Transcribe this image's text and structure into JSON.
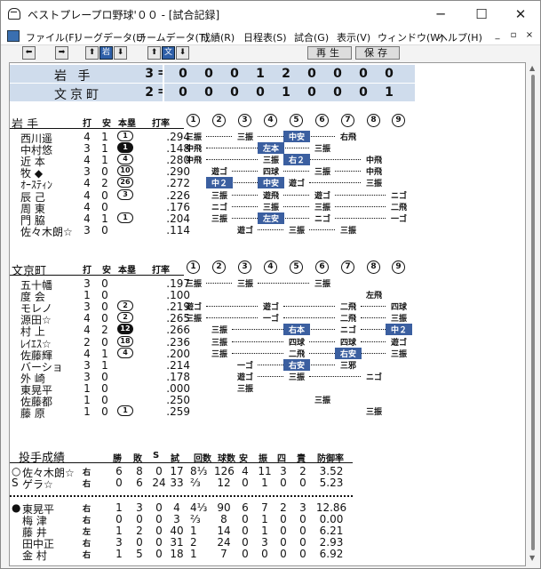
{
  "window": {
    "title": "ベストプレープロ野球'００ - [試合記録]",
    "controls": [
      "─",
      "☐",
      "✕"
    ]
  },
  "menu": {
    "items": [
      "ファイル(F)",
      "リーグデータ(L)",
      "チームデータ(T)",
      "成績(R)",
      "日程表(S)",
      "試合(G)",
      "表示(V)",
      "ウィンドウ(W)",
      "ヘルプ(H)"
    ],
    "mdi": [
      "_",
      "▫",
      "×"
    ]
  },
  "toolbar": {
    "prev": "⬅",
    "next": "➡",
    "iwate_up": "⬆",
    "iwate_label": "岩",
    "iwate_down": "⬇",
    "bunkyo_up": "⬆",
    "bunkyo_label": "文",
    "bunkyo_down": "⬇",
    "replay": "再生",
    "save": "保存"
  },
  "linescore": {
    "teams": [
      {
        "name": "岩 手",
        "total": "3",
        "innings": [
          "0",
          "0",
          "0",
          "1",
          "2",
          "0",
          "0",
          "0",
          "0"
        ]
      },
      {
        "name": "文京町",
        "total": "2",
        "innings": [
          "0",
          "0",
          "0",
          "0",
          "1",
          "0",
          "0",
          "0",
          "1"
        ]
      }
    ],
    "eq": "="
  },
  "headers": {
    "at_bats": "打",
    "hits": "安",
    "hr_rbi": "本塁",
    "avg": "打率",
    "innings": [
      "1",
      "2",
      "3",
      "4",
      "5",
      "6",
      "7",
      "8",
      "9"
    ]
  },
  "iwate": {
    "team": "岩 手",
    "players": [
      {
        "name": "西川遥",
        "ab": "4",
        "h": "1",
        "rbi": "1",
        "filled": false,
        "avg": ".294",
        "res": [
          [
            "0",
            "三振",
            ""
          ],
          [
            "2",
            "三振",
            ""
          ],
          [
            "4",
            "中安",
            "hit"
          ],
          [
            "6",
            "右飛",
            ""
          ]
        ]
      },
      {
        "name": "中村悠",
        "ab": "3",
        "h": "1",
        "rbi": "1",
        "filled": true,
        "avg": ".148",
        "res": [
          [
            "0",
            "中飛",
            ""
          ],
          [
            "3",
            "左本",
            "hit"
          ],
          [
            "5",
            "三振",
            ""
          ]
        ]
      },
      {
        "name": "近 本",
        "ab": "4",
        "h": "1",
        "rbi": "4",
        "filled": false,
        "avg": ".280",
        "res": [
          [
            "0",
            "中飛",
            ""
          ],
          [
            "3",
            "三振",
            ""
          ],
          [
            "4",
            "右２",
            "hit"
          ],
          [
            "7",
            "中飛",
            ""
          ]
        ]
      },
      {
        "name": "牧 ◆",
        "ab": "3",
        "h": "0",
        "rbi": "10",
        "filled": false,
        "avg": ".290",
        "res": [
          [
            "1",
            "遊ゴ",
            ""
          ],
          [
            "3",
            "四球",
            ""
          ],
          [
            "5",
            "三振",
            ""
          ],
          [
            "7",
            "中飛",
            ""
          ]
        ]
      },
      {
        "name": "ｵｰｽﾃｨﾝ",
        "ab": "4",
        "h": "2",
        "rbi": "26",
        "filled": false,
        "avg": ".272",
        "res": [
          [
            "1",
            "中２",
            "hit"
          ],
          [
            "3",
            "中安",
            "hit"
          ],
          [
            "4",
            "遊ゴ",
            ""
          ],
          [
            "7",
            "三振",
            ""
          ]
        ]
      },
      {
        "name": "辰 己",
        "ab": "4",
        "h": "0",
        "rbi": "3",
        "filled": false,
        "avg": ".226",
        "res": [
          [
            "1",
            "三振",
            ""
          ],
          [
            "3",
            "遊飛",
            ""
          ],
          [
            "5",
            "遊ゴ",
            ""
          ],
          [
            "8",
            "ニゴ",
            ""
          ]
        ]
      },
      {
        "name": "周 東",
        "ab": "4",
        "h": "0",
        "rbi": "",
        "filled": false,
        "avg": ".176",
        "res": [
          [
            "1",
            "ニゴ",
            ""
          ],
          [
            "3",
            "三振",
            ""
          ],
          [
            "5",
            "三振",
            ""
          ],
          [
            "8",
            "二飛",
            ""
          ]
        ]
      },
      {
        "name": "門 脇",
        "ab": "4",
        "h": "1",
        "rbi": "1",
        "filled": false,
        "avg": ".204",
        "res": [
          [
            "1",
            "三振",
            ""
          ],
          [
            "3",
            "左安",
            "hit"
          ],
          [
            "5",
            "ニゴ",
            ""
          ],
          [
            "8",
            "一ゴ",
            ""
          ]
        ]
      },
      {
        "name": "佐々木朗☆",
        "ab": "3",
        "h": "0",
        "rbi": "",
        "filled": false,
        "avg": ".114",
        "res": [
          [
            "2",
            "遊ゴ",
            ""
          ],
          [
            "4",
            "三振",
            ""
          ],
          [
            "6",
            "三振",
            ""
          ]
        ]
      }
    ]
  },
  "bunkyo": {
    "team": "文京町",
    "players": [
      {
        "name": "五十幡",
        "ab": "3",
        "h": "0",
        "rbi": "",
        "filled": false,
        "avg": ".197",
        "res": [
          [
            "0",
            "三振",
            ""
          ],
          [
            "2",
            "三振",
            ""
          ],
          [
            "5",
            "三振",
            ""
          ]
        ]
      },
      {
        "name": "度 会",
        "ab": "1",
        "h": "0",
        "rbi": "",
        "filled": false,
        "avg": ".100",
        "res": [
          [
            "7",
            "左飛",
            ""
          ]
        ]
      },
      {
        "name": "モレノ",
        "ab": "3",
        "h": "0",
        "rbi": "2",
        "filled": false,
        "avg": ".219",
        "res": [
          [
            "0",
            "遊ゴ",
            ""
          ],
          [
            "3",
            "遊ゴ",
            ""
          ],
          [
            "6",
            "二飛",
            ""
          ],
          [
            "8",
            "四球",
            ""
          ]
        ]
      },
      {
        "name": "源田☆",
        "ab": "4",
        "h": "0",
        "rbi": "2",
        "filled": false,
        "avg": ".265",
        "res": [
          [
            "0",
            "三振",
            ""
          ],
          [
            "3",
            "一ゴ",
            ""
          ],
          [
            "6",
            "二飛",
            ""
          ],
          [
            "8",
            "三振",
            ""
          ]
        ]
      },
      {
        "name": "村 上",
        "ab": "4",
        "h": "2",
        "rbi": "12",
        "filled": true,
        "avg": ".266",
        "res": [
          [
            "1",
            "三振",
            ""
          ],
          [
            "4",
            "右本",
            "hit"
          ],
          [
            "6",
            "ニゴ",
            ""
          ],
          [
            "8",
            "中２",
            "hit"
          ]
        ]
      },
      {
        "name": "ﾚｲｴｽ☆",
        "ab": "2",
        "h": "0",
        "rbi": "18",
        "filled": false,
        "avg": ".236",
        "res": [
          [
            "1",
            "三振",
            ""
          ],
          [
            "4",
            "四球",
            ""
          ],
          [
            "6",
            "四球",
            ""
          ],
          [
            "8",
            "遊ゴ",
            ""
          ]
        ]
      },
      {
        "name": "佐藤輝",
        "ab": "4",
        "h": "1",
        "rbi": "4",
        "filled": false,
        "avg": ".200",
        "res": [
          [
            "1",
            "三振",
            ""
          ],
          [
            "4",
            "二飛",
            ""
          ],
          [
            "6",
            "右安",
            "hit"
          ],
          [
            "8",
            "三振",
            ""
          ]
        ]
      },
      {
        "name": "バーショ",
        "ab": "3",
        "h": "1",
        "rbi": "",
        "filled": false,
        "avg": ".214",
        "res": [
          [
            "2",
            "一ゴ",
            ""
          ],
          [
            "4",
            "右安",
            "hit"
          ],
          [
            "6",
            "三邪",
            ""
          ]
        ]
      },
      {
        "name": "外 崎",
        "ab": "3",
        "h": "0",
        "rbi": "",
        "filled": false,
        "avg": ".178",
        "res": [
          [
            "2",
            "遊ゴ",
            ""
          ],
          [
            "4",
            "三振",
            ""
          ],
          [
            "7",
            "ニゴ",
            ""
          ]
        ]
      },
      {
        "name": "東晃平",
        "ab": "1",
        "h": "0",
        "rbi": "",
        "filled": false,
        "avg": ".000",
        "res": [
          [
            "2",
            "三振",
            ""
          ]
        ]
      },
      {
        "name": "佐藤都",
        "ab": "1",
        "h": "0",
        "rbi": "",
        "filled": false,
        "avg": ".250",
        "res": [
          [
            "5",
            "三振",
            ""
          ]
        ]
      },
      {
        "name": "藤 原",
        "ab": "1",
        "h": "0",
        "rbi": "1",
        "filled": false,
        "avg": ".259",
        "res": [
          [
            "7",
            "三振",
            ""
          ]
        ]
      }
    ]
  },
  "pitching": {
    "title": "投手成績",
    "headers": [
      "勝",
      "敗",
      "S",
      "試",
      "回数",
      "球数",
      "安",
      "振",
      "四",
      "責",
      "防御率"
    ],
    "iwate": [
      {
        "mark": "○",
        "name": "佐々木朗☆",
        "hand": "右",
        "w": "6",
        "l": "8",
        "s": "0",
        "g": "17",
        "ip": "8⅓",
        "pitches": "126",
        "h": "4",
        "k": "11",
        "bb": "3",
        "er": "2",
        "era": "3.52"
      },
      {
        "mark": "S",
        "name": "ゲラ☆",
        "hand": "右",
        "w": "0",
        "l": "6",
        "s": "24",
        "g": "33",
        "ip": "⅔",
        "pitches": "12",
        "h": "0",
        "k": "1",
        "bb": "0",
        "er": "0",
        "era": "5.23"
      }
    ],
    "bunkyo": [
      {
        "mark": "●",
        "name": "東晃平",
        "hand": "右",
        "w": "1",
        "l": "3",
        "s": "0",
        "g": "4",
        "ip": "4⅓",
        "pitches": "90",
        "h": "6",
        "k": "7",
        "bb": "2",
        "er": "3",
        "era": "12.86"
      },
      {
        "mark": "",
        "name": "梅 津",
        "hand": "右",
        "w": "0",
        "l": "0",
        "s": "0",
        "g": "3",
        "ip": "⅔",
        "pitches": "8",
        "h": "0",
        "k": "1",
        "bb": "0",
        "er": "0",
        "era": "0.00"
      },
      {
        "mark": "",
        "name": "藤 井",
        "hand": "左",
        "w": "1",
        "l": "2",
        "s": "0",
        "g": "40",
        "ip": "1",
        "pitches": "14",
        "h": "0",
        "k": "1",
        "bb": "0",
        "er": "0",
        "era": "6.21"
      },
      {
        "mark": "",
        "name": "田中正",
        "hand": "右",
        "w": "3",
        "l": "0",
        "s": "0",
        "g": "31",
        "ip": "2",
        "pitches": "24",
        "h": "0",
        "k": "3",
        "bb": "0",
        "er": "0",
        "era": "2.93"
      },
      {
        "mark": "",
        "name": "金 村",
        "hand": "右",
        "w": "1",
        "l": "5",
        "s": "0",
        "g": "18",
        "ip": "1",
        "pitches": "7",
        "h": "0",
        "k": "0",
        "bb": "0",
        "er": "0",
        "era": "6.92"
      }
    ]
  },
  "colors": {
    "hit": "#3b5fa0",
    "linescore_bg": "#cfdcec"
  }
}
